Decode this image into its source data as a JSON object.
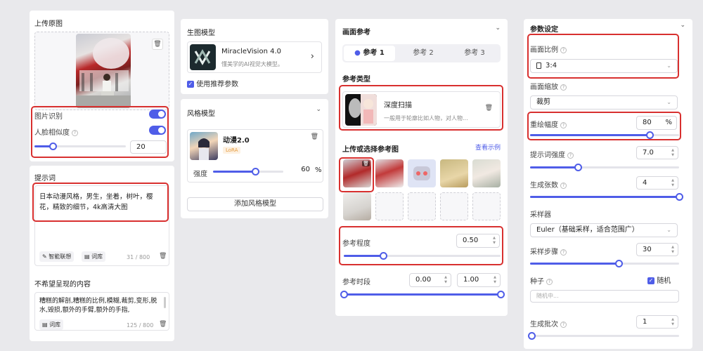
{
  "col1": {
    "upload_title": "上传原图",
    "image_recognition": "图片识别",
    "face_similarity": "人脸相似度",
    "face_similarity_value": "20",
    "face_similarity_fraction": 0.2,
    "prompt_title": "提示词",
    "prompt_text": "日本动漫风格，男生，坐着，树叶，樱花，精致的细节，4k高清大图",
    "smart_assoc": "智能联想",
    "lexicon": "词库",
    "prompt_count": "31 / 800",
    "negative_title": "不希望呈现的内容",
    "negative_text": "糟糕的解剖,糟糕的比例,模糊,裁剪,变形,脱水,毁损,额外的手臂,额外的手指,",
    "negative_count": "125 / 800"
  },
  "col2": {
    "gen_model_title": "生图模型",
    "model_name": "MiracleVision 4.0",
    "model_desc": "懂美学的AI视觉大模型。",
    "use_recommended": "使用推荐参数",
    "style_model_title": "风格模型",
    "style_name": "动漫2.0",
    "style_tag": "LoRA",
    "strength_label": "强度",
    "strength_value": "60",
    "strength_fraction": 0.6,
    "percent": "%",
    "add_style": "添加风格模型"
  },
  "col3": {
    "ref_title": "画面参考",
    "tabs": [
      "参考 1",
      "参考 2",
      "参考 3"
    ],
    "ref_type_title": "参考类型",
    "ref_type_name": "深度扫描",
    "ref_type_desc": "一般用于轮廓比如人物，对人物...",
    "upload_choose": "上传或选择参考图",
    "view_examples": "查看示例",
    "ref_degree_label": "参考程度",
    "ref_degree_value": "0.50",
    "ref_degree_fraction": 0.5,
    "ref_period_label": "参考时段",
    "ref_period_start": "0.00",
    "ref_period_end": "1.00"
  },
  "col4": {
    "params_title": "参数设定",
    "aspect_label": "画面比例",
    "aspect_value": "3:4",
    "scale_label": "画面缩放",
    "scale_value": "裁剪",
    "repaint_label": "重绘幅度",
    "repaint_value": "80",
    "repaint_fraction": 0.8,
    "percent": "%",
    "prompt_strength_label": "提示词强度",
    "prompt_strength_value": "7.0",
    "prompt_strength_fraction": 0.35,
    "count_label": "生成张数",
    "count_value": "4",
    "count_fraction": 1.0,
    "sampler_label": "采样器",
    "sampler_value": "Euler（基础采样，适合范围广）",
    "steps_label": "采样步骤",
    "steps_value": "30",
    "steps_fraction": 0.6,
    "seed_label": "种子",
    "random_label": "随机",
    "seed_placeholder": "随机中...",
    "batch_label": "生成批次",
    "batch_value": "1",
    "batch_fraction": 0.0
  }
}
